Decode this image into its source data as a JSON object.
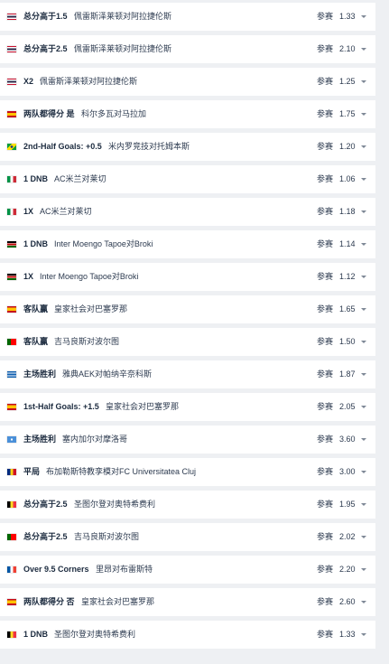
{
  "param_label": "参赛",
  "rows": [
    {
      "flag": "thailand",
      "bet": "总分高于1.5",
      "match": "佩雷斯泽莱顿对阿拉捷伦斯",
      "odds": "1.33"
    },
    {
      "flag": "thailand",
      "bet": "总分高于2.5",
      "match": "佩雷斯泽莱顿对阿拉捷伦斯",
      "odds": "2.10"
    },
    {
      "flag": "thailand",
      "bet": "X2",
      "match": "佩雷斯泽莱顿对阿拉捷伦斯",
      "odds": "1.25"
    },
    {
      "flag": "spain",
      "bet": "两队都得分 是",
      "match": "科尔多瓦对马拉加",
      "odds": "1.75"
    },
    {
      "flag": "brazil",
      "bet": "2nd-Half Goals: +0.5",
      "match": "米内罗竞技对托姆本斯",
      "odds": "1.20"
    },
    {
      "flag": "italy",
      "bet": "1 DNB",
      "match": "AC米兰对莱切",
      "odds": "1.06"
    },
    {
      "flag": "italy",
      "bet": "1X",
      "match": "AC米兰对莱切",
      "odds": "1.18"
    },
    {
      "flag": "kenya",
      "bet": "1 DNB",
      "match": "Inter Moengo Tapoe对Broki",
      "odds": "1.14"
    },
    {
      "flag": "kenya",
      "bet": "1X",
      "match": "Inter Moengo Tapoe对Broki",
      "odds": "1.12"
    },
    {
      "flag": "spain",
      "bet": "客队赢",
      "match": "皇家社会对巴塞罗那",
      "odds": "1.65"
    },
    {
      "flag": "portugal",
      "bet": "客队赢",
      "match": "吉马良斯对波尔图",
      "odds": "1.50"
    },
    {
      "flag": "greece",
      "bet": "主场胜利",
      "match": "雅典AEK对帕纳辛奈科斯",
      "odds": "1.87"
    },
    {
      "flag": "spain",
      "bet": "1st-Half Goals: +1.5",
      "match": "皇家社会对巴塞罗那",
      "odds": "2.05"
    },
    {
      "flag": "world",
      "bet": "主场胜利",
      "match": "塞内加尔对摩洛哥",
      "odds": "3.60"
    },
    {
      "flag": "romania",
      "bet": "平局",
      "match": "布加勒斯特教孪模对FC Universitatea Cluj",
      "odds": "3.00"
    },
    {
      "flag": "belgium",
      "bet": "总分高于2.5",
      "match": "圣图尔登对奥特希费利",
      "odds": "1.95"
    },
    {
      "flag": "portugal",
      "bet": "总分高于2.5",
      "match": "吉马良斯对波尔图",
      "odds": "2.02"
    },
    {
      "flag": "france",
      "bet": "Over 9.5 Corners",
      "match": "里昂对布雷斯特",
      "odds": "2.20"
    },
    {
      "flag": "spain",
      "bet": "两队都得分 否",
      "match": "皇家社会对巴塞罗那",
      "odds": "2.60"
    },
    {
      "flag": "belgium",
      "bet": "1 DNB",
      "match": "圣图尔登对奥特希费利",
      "odds": "1.33"
    }
  ]
}
